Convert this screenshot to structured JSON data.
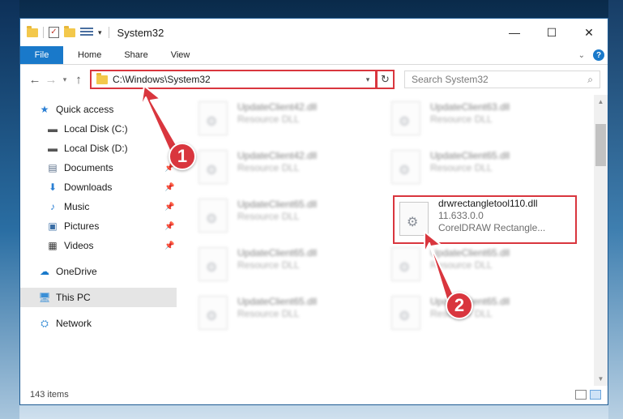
{
  "window": {
    "title": "System32",
    "controls": {
      "minimize": "—",
      "maximize": "☐",
      "close": "✕"
    }
  },
  "quick_access_icons": [
    "folder-icon",
    "properties-check-icon",
    "new-folder-icon",
    "customize-icon"
  ],
  "ribbon": {
    "tabs": [
      "File",
      "Home",
      "Share",
      "View"
    ],
    "help": "?"
  },
  "nav": {
    "address": "C:\\Windows\\System32",
    "search_placeholder": "Search System32"
  },
  "sidebar": {
    "items": [
      {
        "label": "Quick access",
        "icon": "star-icon",
        "pinned": false
      },
      {
        "label": "Local Disk (C:)",
        "icon": "drive-icon",
        "pinned": false
      },
      {
        "label": "Local Disk (D:)",
        "icon": "drive-icon",
        "pinned": false
      },
      {
        "label": "Documents",
        "icon": "documents-icon",
        "pinned": true
      },
      {
        "label": "Downloads",
        "icon": "download-icon",
        "pinned": true
      },
      {
        "label": "Music",
        "icon": "music-icon",
        "pinned": true
      },
      {
        "label": "Pictures",
        "icon": "pictures-icon",
        "pinned": true
      },
      {
        "label": "Videos",
        "icon": "videos-icon",
        "pinned": true
      },
      {
        "label": "OneDrive",
        "icon": "cloud-icon",
        "pinned": false
      },
      {
        "label": "This PC",
        "icon": "computer-icon",
        "pinned": false,
        "selected": true
      },
      {
        "label": "Network",
        "icon": "network-icon",
        "pinned": false
      }
    ]
  },
  "files": {
    "left_column": [
      {
        "name": "UpdateClient42.dll",
        "sub": "Resource DLL"
      },
      {
        "name": "UpdateClient42.dll",
        "sub": "Resource DLL"
      },
      {
        "name": "UpdateClient65.dll",
        "sub": "Resource DLL"
      },
      {
        "name": "UpdateClient65.dll",
        "sub": "Resource DLL"
      },
      {
        "name": "UpdateClient65.dll",
        "sub": "Resource DLL"
      }
    ],
    "right_column": [
      {
        "name": "UpdateClient63.dll",
        "sub": "Resource DLL"
      },
      {
        "name": "UpdateClient65.dll",
        "sub": "Resource DLL"
      },
      {
        "name": "drwrectangletool110.dll",
        "sub": "11.633.0.0",
        "sub2": "CorelDRAW Rectangle...",
        "highlighted": true
      },
      {
        "name": "UpdateClient65.dll",
        "sub": "Resource DLL"
      },
      {
        "name": "UpdateClient65.dll",
        "sub": "Resource DLL"
      }
    ]
  },
  "status": {
    "item_count": "143 items"
  },
  "annotations": {
    "step1": "1",
    "step2": "2"
  },
  "colors": {
    "accent": "#1979ca",
    "highlight": "#d9363e"
  }
}
